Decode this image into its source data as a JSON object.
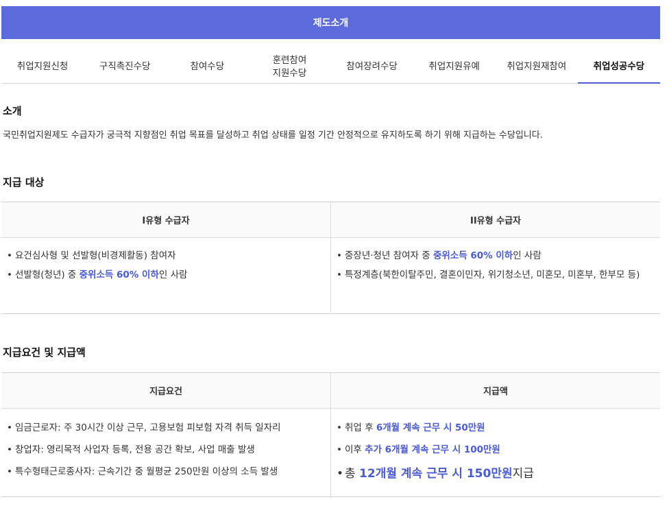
{
  "header": {
    "title": "제도소개"
  },
  "tabs": [
    {
      "label": "취업지원신청"
    },
    {
      "label": "구직촉진수당"
    },
    {
      "label": "참여수당"
    },
    {
      "label": "훈련참여\n지원수당"
    },
    {
      "label": "참여장려수당"
    },
    {
      "label": "취업지원유예"
    },
    {
      "label": "취업지원재참여"
    },
    {
      "label": "취업성공수당"
    }
  ],
  "intro": {
    "title": "소개",
    "text": "국민취업지원제도 수급자가 궁극적 지향점인 취업 목표를 달성하고 취업 상태를 일정 기간 안정적으로 유지하도록 하기 위해 지급하는 수당입니다."
  },
  "eligibility": {
    "title": "지급 대상",
    "col1_header": "I유형 수급자",
    "col2_header": "II유형 수급자",
    "col1_items": [
      {
        "text": "요건심사형 및 선발형(비경제활동) 참여자"
      },
      {
        "pre": "선발형(청년) 중 ",
        "hl": "중위소득 60% 이하",
        "post": "인 사람"
      }
    ],
    "col2_items": [
      {
        "pre": "중장년·청년 참여자 중 ",
        "hl": "중위소득 60% 이하",
        "post": "인 사람"
      },
      {
        "text": "특정계층(북한이탈주민, 결혼이민자, 위기청소년, 미혼모, 미혼부, 한부모 등)"
      }
    ]
  },
  "payment": {
    "title": "지급요건 및 지급액",
    "col1_header": "지급요건",
    "col2_header": "지급액",
    "col1_items": [
      {
        "text": "임금근로자: 주 30시간 이상 근무, 고용보험 피보험 자격 취득 일자리"
      },
      {
        "text": "창업자: 영리목적 사업자 등록, 전용 공간 확보, 사업 매출 발생"
      },
      {
        "text": "특수형태근로종사자: 근속기간 중 월평균 250만원 이상의 소득 발생"
      }
    ],
    "col2_items": [
      {
        "pre": "취업 후 ",
        "hl": "6개월 계속 근무 시 50만원"
      },
      {
        "pre": "이후 ",
        "hl": "추가 6개월 계속 근무 시 100만원"
      }
    ],
    "total": {
      "pre": "총 ",
      "hl": "12개월 계속 근무 시 150만원",
      "post": "지급"
    }
  }
}
